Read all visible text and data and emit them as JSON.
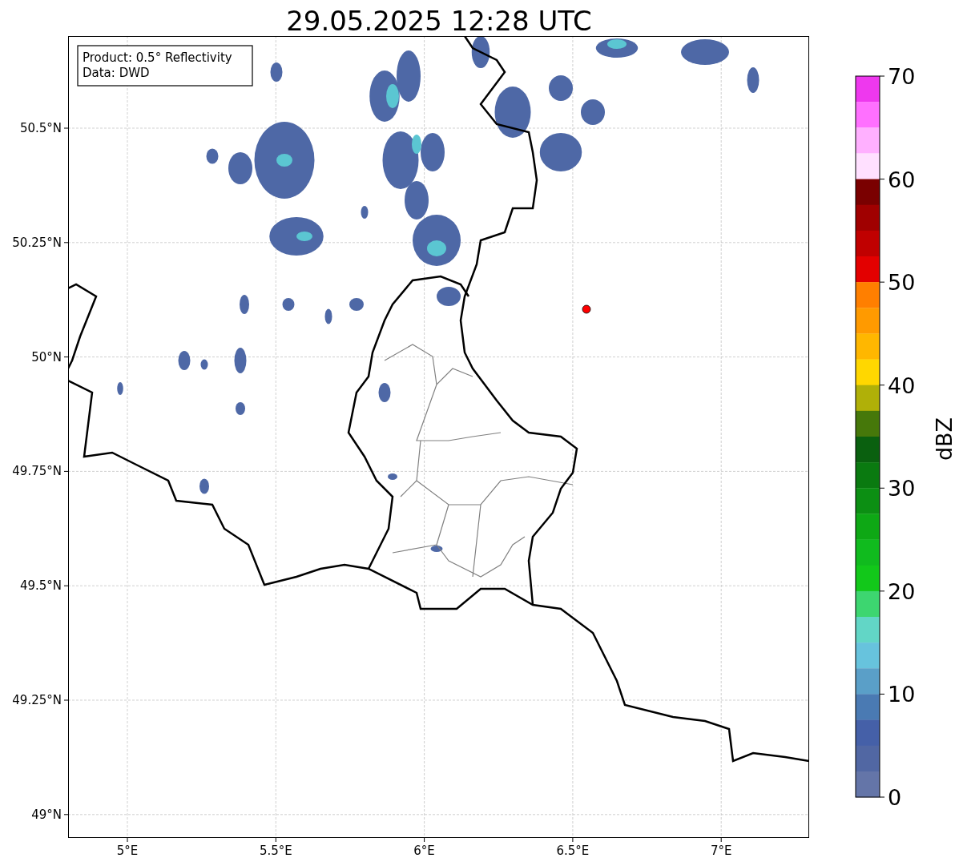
{
  "title": "29.05.2025 12:28 UTC",
  "legend": [
    "Product: 0.5° Reflectivity",
    "Data: DWD"
  ],
  "map": {
    "x_ticks": [
      "5°E",
      "5.5°E",
      "6°E",
      "6.5°E",
      "7°E"
    ],
    "y_ticks": [
      "50.5°N",
      "50.25°N",
      "50°N",
      "49.75°N",
      "49.5°N",
      "49.25°N",
      "49°N"
    ]
  },
  "colorbar": {
    "label": "dBZ",
    "ticks": [
      "70",
      "60",
      "50",
      "40",
      "30",
      "20",
      "10",
      "0"
    ],
    "bands": [
      {
        "color": "#ee38ee"
      },
      {
        "color": "#ff70ff"
      },
      {
        "color": "#ffb0ff"
      },
      {
        "color": "#ffe0ff"
      },
      {
        "color": "#7a0000"
      },
      {
        "color": "#a00000"
      },
      {
        "color": "#c00000"
      },
      {
        "color": "#e30000"
      },
      {
        "color": "#ff7f00"
      },
      {
        "color": "#ff9a00"
      },
      {
        "color": "#ffb700"
      },
      {
        "color": "#ffd700"
      },
      {
        "color": "#b0b008"
      },
      {
        "color": "#46780a"
      },
      {
        "color": "#0a600f"
      },
      {
        "color": "#0a7a10"
      },
      {
        "color": "#0c8f13"
      },
      {
        "color": "#0ea815"
      },
      {
        "color": "#10bb1e"
      },
      {
        "color": "#12c81a"
      },
      {
        "color": "#3dd670"
      },
      {
        "color": "#62d6c6"
      },
      {
        "color": "#67c3dd"
      },
      {
        "color": "#5a9fc8"
      },
      {
        "color": "#4a7ab3"
      },
      {
        "color": "#4560a8"
      },
      {
        "color": "#5167a3"
      },
      {
        "color": "#6475a8"
      }
    ]
  }
}
